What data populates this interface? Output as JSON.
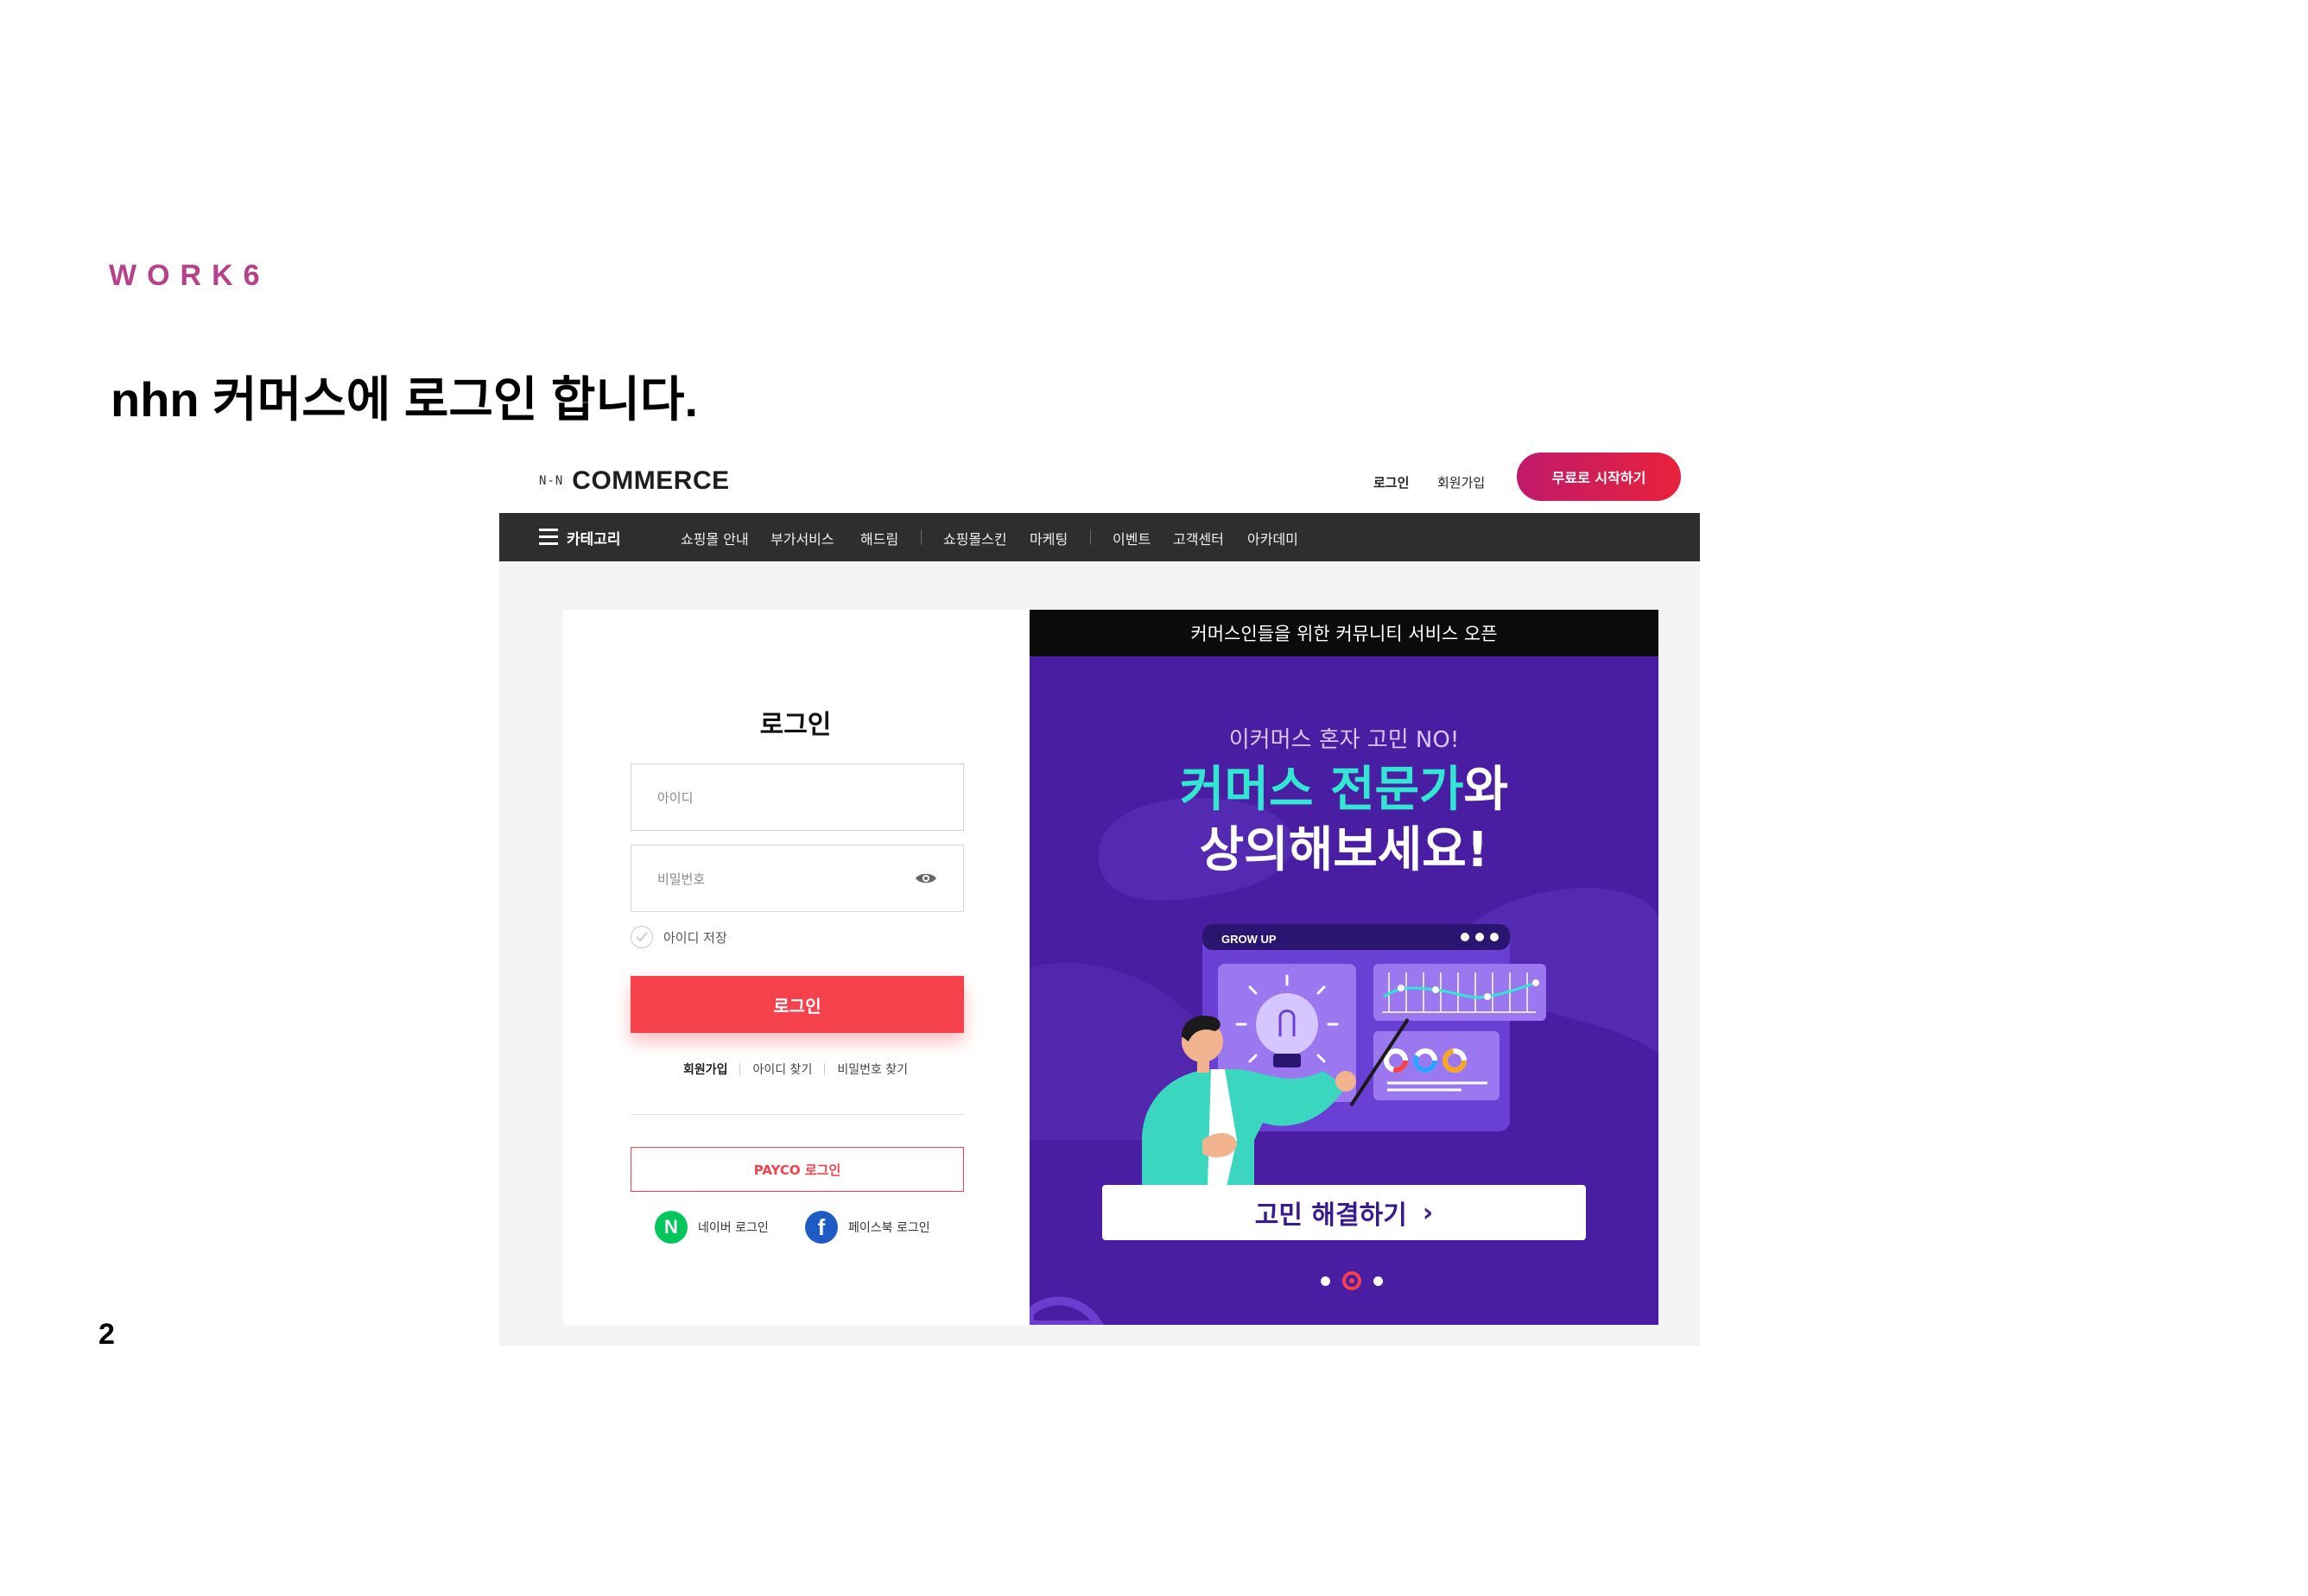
{
  "slide": {
    "tag": "WORK6",
    "title": "nhn 커머스에 로그인 합니다.",
    "page_number": "2"
  },
  "header": {
    "logo_mark": "N-N",
    "logo_text": "COMMERCE",
    "login_link": "로그인",
    "signup_link": "회원가입",
    "cta_button": "무료로 시작하기",
    "cta_gradient": [
      "#c01a6c",
      "#e8223b"
    ]
  },
  "nav": {
    "category_label": "카테고리",
    "items": [
      "쇼핑몰 안내",
      "부가서비스",
      "해드림",
      "쇼핑몰스킨",
      "마케팅",
      "이벤트",
      "고객센터",
      "아카데미"
    ]
  },
  "login": {
    "title": "로그인",
    "id_placeholder": "아이디",
    "password_placeholder": "비밀번호",
    "save_id_label": "아이디 저장",
    "submit_label": "로그인",
    "links": [
      "회원가입",
      "아이디 찾기",
      "비밀번호 찾기"
    ],
    "payco_label": "PAYCO 로그인",
    "naver_label": "네이버 로그인",
    "naver_icon_letter": "N",
    "facebook_label": "페이스북 로그인",
    "facebook_icon_letter": "f",
    "accent_color": "#f5414b"
  },
  "banner": {
    "top_text": "커머스인들을 위한 커뮤니티 서비스 오픈",
    "subtitle": "이커머스 혼자 고민 NO!",
    "headline_highlight": "커머스 전문가",
    "headline_rest": "와",
    "headline_line2": "상의해보세요!",
    "illustration_label": "GROW UP",
    "button_label": "고민 해결하기",
    "button_chevron": "›",
    "carousel_count": 3,
    "carousel_active_index": 1,
    "background_color": "#4a1ea3",
    "highlight_color": "#33e6d2"
  }
}
